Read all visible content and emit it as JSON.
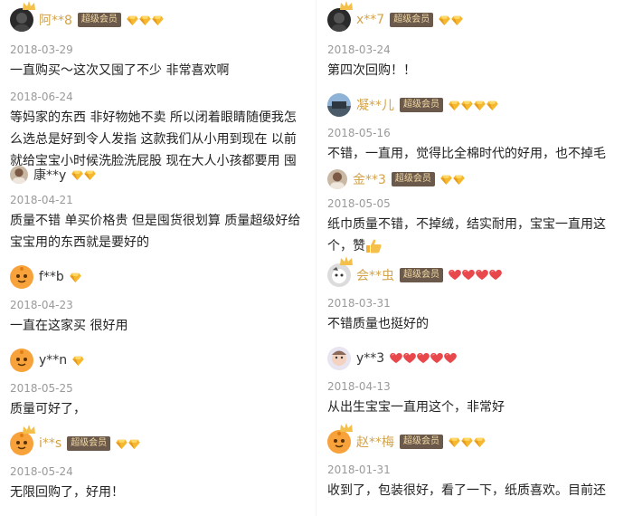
{
  "vip_label": "超级会员",
  "left": {
    "reviews": [
      {
        "user": "阿**8",
        "vip": true,
        "badge_type": "gold-diamond",
        "badge_count": 3,
        "avatar": "dark-portrait",
        "date": "2018-03-29",
        "text": "一直购买～这次又囤了不少 非常喜欢啊"
      },
      {
        "date": "2018-06-24",
        "text": "等妈家的东西 非好物她不卖 所以闭着眼睛随便我怎么选总是好到令人发指 这款我们从小用到现在 以前就给宝宝小时候洗脸洗屁股 现在大人小孩都要用 囤"
      },
      {
        "user": "康**y",
        "vip": false,
        "badge_type": "gold-diamond",
        "badge_count": 2,
        "avatar": "photo",
        "date": "2018-04-21",
        "text": "质量不错 单买价格贵 但是囤货很划算 质量超级好给宝宝用的东西就是要好的"
      },
      {
        "user": "f**b",
        "vip": false,
        "badge_type": "gold-diamond",
        "badge_count": 1,
        "avatar": "orange-default",
        "date": "2018-04-23",
        "text": "一直在这家买 很好用"
      },
      {
        "user": "y**n",
        "vip": false,
        "badge_type": "gold-diamond",
        "badge_count": 1,
        "avatar": "orange-default",
        "date": "2018-05-25",
        "text": "质量可好了，"
      },
      {
        "user": "i**s",
        "vip": true,
        "badge_type": "gold-diamond",
        "badge_count": 2,
        "avatar": "orange-default",
        "date": "2018-05-24",
        "text": "无限回购了，好用！"
      }
    ]
  },
  "right": {
    "reviews": [
      {
        "user": "x**7",
        "vip": true,
        "badge_type": "gold-diamond",
        "badge_count": 2,
        "avatar": "dark-portrait",
        "date": "2018-03-24",
        "text": "第四次回购！！"
      },
      {
        "user": "凝**儿",
        "vip": true,
        "badge_type": "gold-diamond",
        "badge_count": 4,
        "avatar": "landscape",
        "date": "2018-05-16",
        "text": "不错，一直用，觉得比全棉时代的好用，也不掉毛"
      },
      {
        "user": "金**3",
        "vip": true,
        "badge_type": "gold-diamond",
        "badge_count": 2,
        "avatar": "photo",
        "date": "2018-05-05",
        "text": "纸巾质量不错，不掉绒，结实耐用，宝宝一直用这个，赞"
      },
      {
        "user": "会**虫",
        "vip": true,
        "badge_type": "red-heart",
        "badge_count": 4,
        "avatar": "cartoon",
        "date": "2018-03-31",
        "text": "不错质量也挺好的"
      },
      {
        "user": "y**3",
        "vip": false,
        "badge_type": "red-heart",
        "badge_count": 5,
        "avatar": "baby",
        "date": "2018-04-13",
        "text": "从出生宝宝一直用这个，非常好"
      },
      {
        "user": "赵**梅",
        "vip": true,
        "badge_type": "gold-diamond",
        "badge_count": 3,
        "avatar": "orange-default",
        "date": "2018-01-31",
        "text": "收到了，包装很好，看了一下，纸质喜欢。目前还"
      }
    ]
  },
  "colors": {
    "gold_name": "#d4a34a",
    "vip_bg": "#6b5a4b",
    "vip_text": "#f3d9a6",
    "diamond": "#f2b33a",
    "heart": "#e8474b",
    "date": "#9a9a9a"
  }
}
